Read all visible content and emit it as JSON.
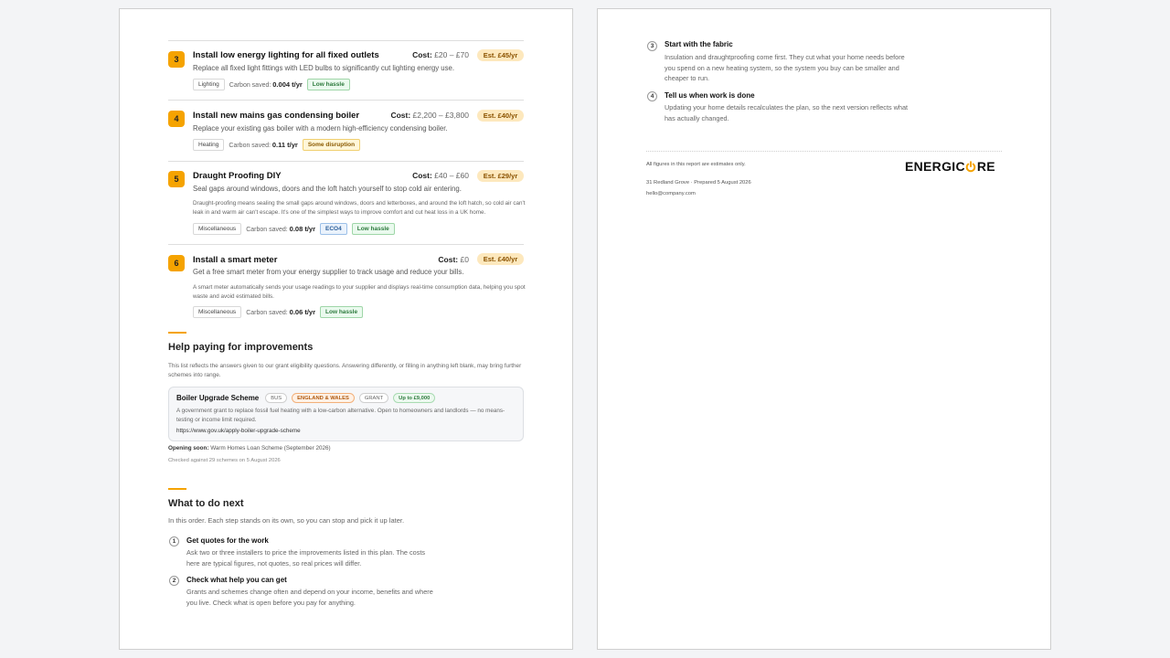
{
  "measures": [
    {
      "number": "3",
      "title": "Install low energy lighting for all fixed outlets",
      "cost_label": "Cost:",
      "cost_value": "£20 – £70",
      "estimate": "Est. £45/yr",
      "description": "Replace all fixed light fittings with LED bulbs to significantly cut lighting energy use.",
      "category": "Lighting",
      "carbon_label": "Carbon saved:",
      "carbon_value": "0.004 t/yr",
      "hassle": "Low hassle"
    },
    {
      "number": "4",
      "title": "Install new mains gas condensing boiler",
      "cost_label": "Cost:",
      "cost_value": "£2,200 – £3,800",
      "estimate": "Est. £40/yr",
      "description": "Replace your existing gas boiler with a modern high-efficiency condensing boiler.",
      "category": "Heating",
      "carbon_label": "Carbon saved:",
      "carbon_value": "0.11 t/yr",
      "hassle": "Some disruption"
    },
    {
      "number": "5",
      "title": "Draught Proofing DIY",
      "cost_label": "Cost:",
      "cost_value": "£40 – £60",
      "estimate": "Est. £29/yr",
      "description": "Seal gaps around windows, doors and the loft hatch yourself to stop cold air entering.",
      "detail": "Draught-proofing means sealing the small gaps around windows, doors and letterboxes, and around the loft hatch, so cold air can't leak in and warm air can't escape. It's one of the simplest ways to improve comfort and cut heat loss in a UK home.",
      "category": "Miscellaneous",
      "carbon_label": "Carbon saved:",
      "carbon_value": "0.08 t/yr",
      "extra_tag": "ECO4",
      "hassle": "Low hassle"
    },
    {
      "number": "6",
      "title": "Install a smart meter",
      "cost_label": "Cost:",
      "cost_value": "£0",
      "estimate": "Est. £40/yr",
      "description": "Get a free smart meter from your energy supplier to track usage and reduce your bills.",
      "detail": "A smart meter automatically sends your usage readings to your supplier and displays real-time consumption data, helping you spot waste and avoid estimated bills.",
      "category": "Miscellaneous",
      "carbon_label": "Carbon saved:",
      "carbon_value": "0.06 t/yr",
      "hassle": "Low hassle"
    }
  ],
  "help": {
    "heading": "Help paying for improvements",
    "intro": "This list reflects the answers given to our grant eligibility questions. Answering differently, or filling in anything left blank, may bring further schemes into range.",
    "scheme": {
      "name": "Boiler Upgrade Scheme",
      "chips": [
        "BUS",
        "ENGLAND & WALES",
        "GRANT",
        "Up to £9,000"
      ],
      "description": "A government grant to replace fossil fuel heating with a low-carbon alternative. Open to homeowners and landlords — no means-testing or income limit required.",
      "link": "https://www.gov.uk/apply-boiler-upgrade-scheme"
    },
    "opening_soon_label": "Opening soon:",
    "opening_soon_value": "Warm Homes Loan Scheme (September 2026)",
    "checked": "Checked against 29 schemes on 5 August 2026"
  },
  "next": {
    "heading": "What to do next",
    "intro": "In this order. Each step stands on its own, so you can stop and pick it up later.",
    "steps": [
      {
        "number": "1",
        "title": "Get quotes for the work",
        "body": "Ask two or three installers to price the improvements listed in this plan. The costs here are typical figures, not quotes, so real prices will differ."
      },
      {
        "number": "2",
        "title": "Check what help you can get",
        "body": "Grants and schemes change often and depend on your income, benefits and where you live. Check what is open before you pay for anything."
      },
      {
        "number": "3",
        "title": "Start with the fabric",
        "body": "Insulation and draughtproofing come first. They cut what your home needs before you spend on a new heating system, so the system you buy can be smaller and cheaper to run."
      },
      {
        "number": "4",
        "title": "Tell us when work is done",
        "body": "Updating your home details recalculates the plan, so the next version reflects what has actually changed."
      }
    ]
  },
  "footer": {
    "disclaimer": "All figures in this report are estimates only.",
    "address": "31 Redland Grove · Prepared 5 August 2026",
    "email": "hello@company.com",
    "logo_left": "ENERGIC",
    "logo_right": "RE",
    "brand_color": "#f5a300"
  }
}
